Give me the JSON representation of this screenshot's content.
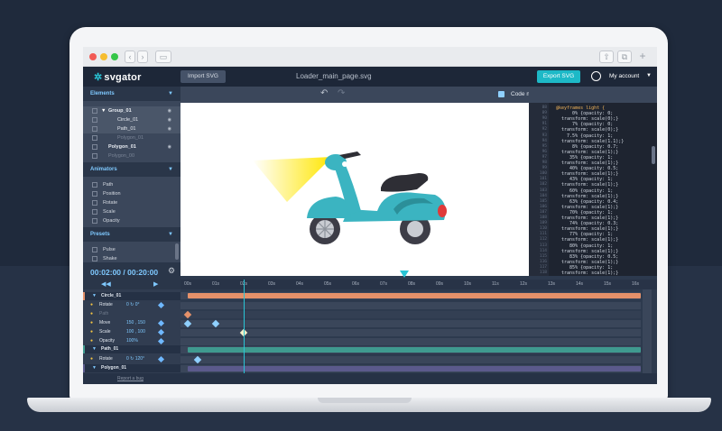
{
  "browser": {
    "back_glyph": "‹",
    "forward_glyph": "›",
    "sidebar_glyph": "▭",
    "share_glyph": "⇧",
    "tabs_glyph": "⧉",
    "newtab_glyph": "+"
  },
  "header": {
    "logo": "svgator",
    "import_label": "Import SVG",
    "filename": "Loader_main_page.svg",
    "export_label": "Export SVG",
    "account_label": "My account"
  },
  "elements_panel": {
    "title": "Elements",
    "items": [
      {
        "label": "Group_01"
      },
      {
        "label": "Circle_01"
      },
      {
        "label": "Path_01"
      },
      {
        "label": "Polygon_01"
      },
      {
        "label": "Polygon_01"
      },
      {
        "label": "Polygon_00"
      }
    ]
  },
  "animators_panel": {
    "title": "Animators",
    "items": [
      "Path",
      "Position",
      "Rotate",
      "Scale",
      "Opacity"
    ]
  },
  "presets_panel": {
    "title": "Presets",
    "items": [
      "Pulse",
      "Shake"
    ]
  },
  "time": "00:02:00 / 00:20:00",
  "toolbar": {
    "code_manager": "Code manager"
  },
  "code": {
    "line_numbers": [
      88,
      89,
      90,
      91,
      92,
      93,
      94,
      95,
      96,
      97,
      98,
      99,
      100,
      101,
      102,
      103,
      104,
      105,
      106,
      107,
      108,
      109,
      110,
      111,
      112,
      113,
      114,
      115,
      116,
      117,
      118
    ],
    "lines": [
      "@keyframes light {",
      "      0% {opacity: 0;",
      "  transform: scale(0);}",
      "      7% {opacity: 0;",
      "  transform: scale(0);}",
      "    7.5% {opacity: 1;",
      "  transform: scale(1.1);}",
      "      8% {opacity: 0.7;",
      "  transform: scale(1);}",
      "     35% {opacity: 1;",
      "  transform: scale(1);}",
      "     40% {opacity: 0.5;",
      "  transform: scale(1);}",
      "     43% {opacity: 1;",
      "  transform: scale(1);}",
      "     60% {opacity: 1;",
      "  transform: scale(1);}",
      "     63% {opacity: 0.4;",
      "  transform: scale(1);}",
      "     70% {opacity: 1;",
      "  transform: scale(1);}",
      "     74% {opacity: 0.3;",
      "  transform: scale(1);}",
      "     77% {opacity: 1;",
      "  transform: scale(1);}",
      "     80% {opacity: 1;",
      "  transform: scale(1);}",
      "     83% {opacity: 0.5;",
      "  transform: scale(1);}",
      "     85% {opacity: 1;",
      "  transform: scale(1);}"
    ]
  },
  "timeline": {
    "ticks": [
      "00s",
      "01s",
      "02s",
      "03s",
      "04s",
      "05s",
      "06s",
      "07s",
      "08s",
      "09s",
      "10s",
      "11s",
      "12s",
      "13s",
      "14s",
      "15s",
      "16s"
    ],
    "rows": [
      {
        "name": "Circle_01",
        "value": "",
        "type": "group"
      },
      {
        "name": "Rotate",
        "value": "0 ↻ 0°",
        "type": "prop"
      },
      {
        "name": "Path",
        "value": "",
        "type": "prop-dim"
      },
      {
        "name": "Move",
        "value": "150 , 150",
        "type": "prop"
      },
      {
        "name": "Scale",
        "value": "100 , 100",
        "type": "prop"
      },
      {
        "name": "Opacity",
        "value": "100%",
        "type": "prop"
      },
      {
        "name": "Path_01",
        "value": "",
        "type": "group"
      },
      {
        "name": "Rotate",
        "value": "0 ↻ 120°",
        "type": "prop"
      },
      {
        "name": "Polygon_01",
        "value": "",
        "type": "group"
      }
    ],
    "report_label": "Report a bug"
  },
  "colors": {
    "accent": "#29c5d6",
    "scooter_body": "#3bb4c1",
    "scooter_dark": "#2b8f99",
    "seat": "#2e2e35",
    "light_beam": "#ffe600",
    "track_orange": "#e5916a",
    "track_teal": "#3f9a8f",
    "track_purple": "#5b5a8c"
  }
}
